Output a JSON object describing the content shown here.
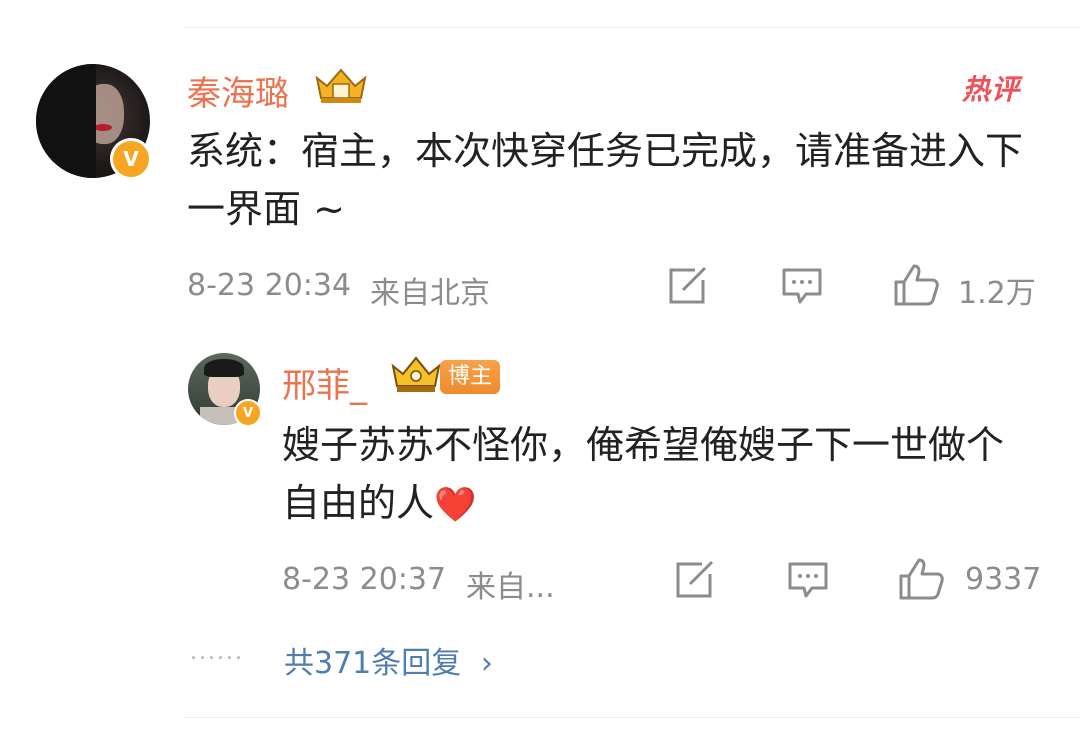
{
  "comment": {
    "username": "秦海璐",
    "hot_label": "热评",
    "text": "系统：宿主，本次快穿任务已完成，请准备进入下一界面 ~",
    "time": "8-23 20:34",
    "location": "来自北京",
    "like_count": "1.2万"
  },
  "reply": {
    "username": "邢菲_",
    "tag": "博主",
    "text": "嫂子苏苏不怪你，俺希望俺嫂子下一世做个自由的人",
    "emoji": "❤️",
    "time": "8-23 20:37",
    "location": "来自...",
    "like_count": "9337"
  },
  "more": {
    "dots": "......",
    "label": "共371条回复",
    "chevron": "›"
  },
  "colors": {
    "username": "#eb7350",
    "link": "#507daf",
    "meta": "#8c8c8c",
    "badge": "#f6a623"
  },
  "icons": [
    "verified-v-icon",
    "crown-badge-icon",
    "share-icon",
    "comment-icon",
    "like-icon",
    "chevron-right-icon"
  ]
}
